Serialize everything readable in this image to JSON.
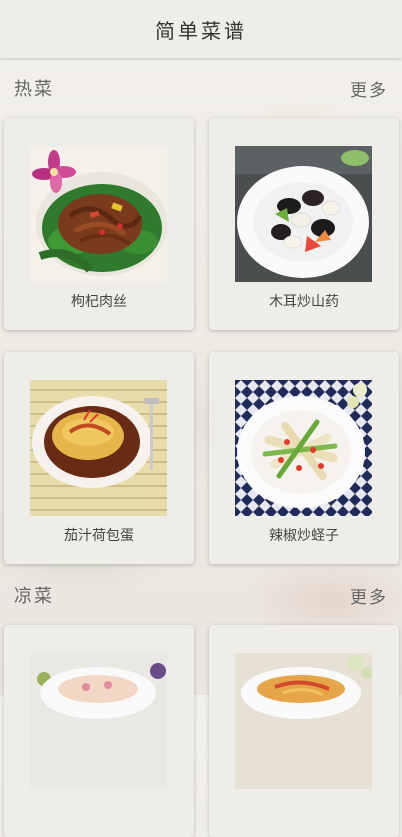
{
  "app": {
    "title": "简单菜谱"
  },
  "sections": [
    {
      "name": "热菜",
      "more": "更多",
      "recipes": [
        {
          "name": "枸杞肉丝"
        },
        {
          "name": "木耳炒山药"
        },
        {
          "name": "茄汁荷包蛋"
        },
        {
          "name": "辣椒炒蛏子"
        }
      ]
    },
    {
      "name": "凉菜",
      "more": "更多",
      "recipes": [
        {},
        {}
      ]
    }
  ]
}
